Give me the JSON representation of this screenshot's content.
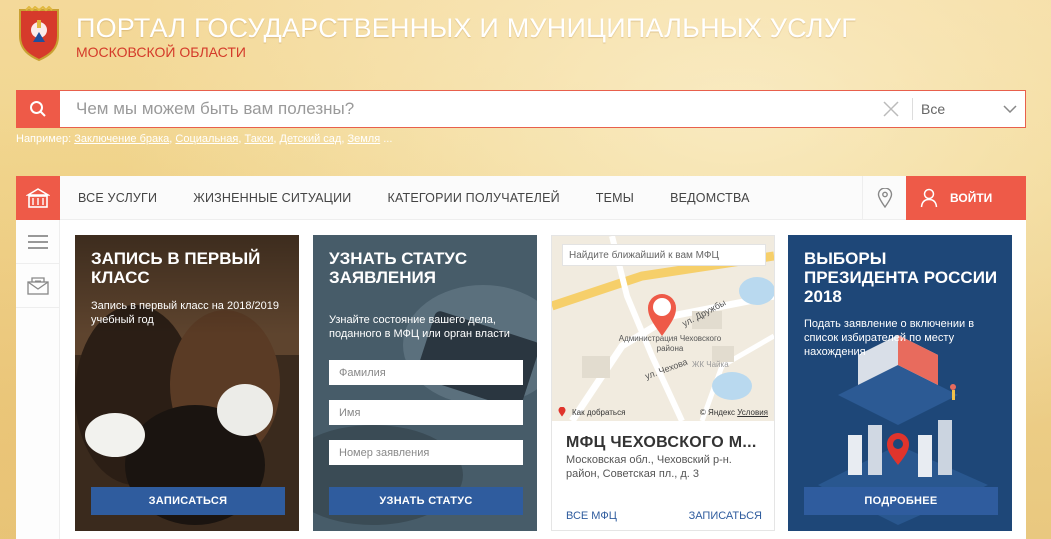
{
  "header": {
    "title": "ПОРТАЛ ГОСУДАРСТВЕННЫХ И МУНИЦИПАЛЬНЫХ УСЛУГ",
    "subtitle": "МОСКОВСКОЙ ОБЛАСТИ",
    "coat_icon": "coat-of-arms-icon"
  },
  "search": {
    "placeholder": "Чем мы можем быть вам полезны?",
    "scope_value": "Все",
    "examples_label": "Например:",
    "examples": [
      "Заключение брака",
      "Социальная",
      "Такси",
      "Детский сад",
      "Земля"
    ]
  },
  "nav": {
    "items": [
      "ВСЕ УСЛУГИ",
      "ЖИЗНЕННЫЕ СИТУАЦИИ",
      "КАТЕГОРИИ ПОЛУЧАТЕЛЕЙ",
      "ТЕМЫ",
      "ВЕДОМСТВА"
    ],
    "login_label": "ВОЙТИ"
  },
  "cards": {
    "first_grade": {
      "title": "ЗАПИСЬ В ПЕРВЫЙ КЛАСС",
      "desc": "Запись в первый класс на 2018/2019 учебный год",
      "button": "ЗАПИСАТЬСЯ"
    },
    "status": {
      "title": "УЗНАТЬ СТАТУС ЗАЯВЛЕНИЯ",
      "desc": "Узнайте состояние вашего дела, поданного в МФЦ или орган власти",
      "surname_placeholder": "Фамилия",
      "name_placeholder": "Имя",
      "number_placeholder": "Номер заявления",
      "button": "УЗНАТЬ СТАТУС"
    },
    "mfc": {
      "map_search_placeholder": "Найдите ближайший к вам МФЦ",
      "map_label_admin": "Администрация Чеховского района",
      "street_druzhby": "ул. Дружбы",
      "street_chekhova": "ул. Чехова",
      "jk_label": "ЖК Чайка",
      "route_label": "Как добраться",
      "yandex_label": "© Яндекс",
      "terms_label": "Условия",
      "title": "МФЦ ЧЕХОВСКОГО М...",
      "address": "Московская обл., Чеховский р-н. район, Советская пл., д. 3",
      "all_link": "ВСЕ МФЦ",
      "signup_link": "ЗАПИСАТЬСЯ"
    },
    "elections": {
      "title": "ВЫБОРЫ ПРЕЗИДЕНТА РОССИИ 2018",
      "desc": "Подать заявление о включении в список избирателей по месту нахождения",
      "button": "ПОДРОБНЕЕ"
    }
  },
  "colors": {
    "accent": "#ee5a48",
    "brand_blue": "#2f5c9e",
    "title_red": "#d43a2a"
  }
}
